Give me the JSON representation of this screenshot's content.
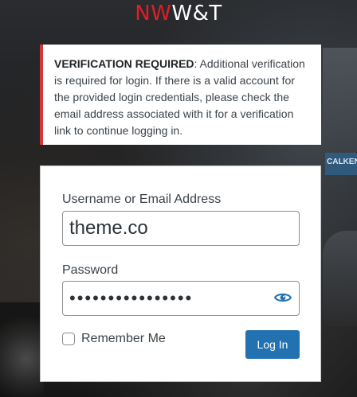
{
  "logo": {
    "part1": "NW",
    "part2": "W&T",
    "color_red": "#e01e26",
    "color_white": "#ffffff"
  },
  "background": {
    "sign_text": "CALKEN"
  },
  "notice": {
    "heading": "VERIFICATION REQUIRED",
    "body": ": Additional verification is required for login. If there is a valid account for the provided login credentials, please check the email address associated with it for a verification link to continue logging in.",
    "border_color": "#d63638"
  },
  "login_form": {
    "username_label": "Username or Email Address",
    "username_value": "theme.co",
    "password_label": "Password",
    "password_value": "••••••••••••••••",
    "show_password_icon": "eye-icon",
    "remember_label": "Remember Me",
    "remember_checked": false,
    "submit_label": "Log In",
    "accent_color": "#2271b1"
  }
}
